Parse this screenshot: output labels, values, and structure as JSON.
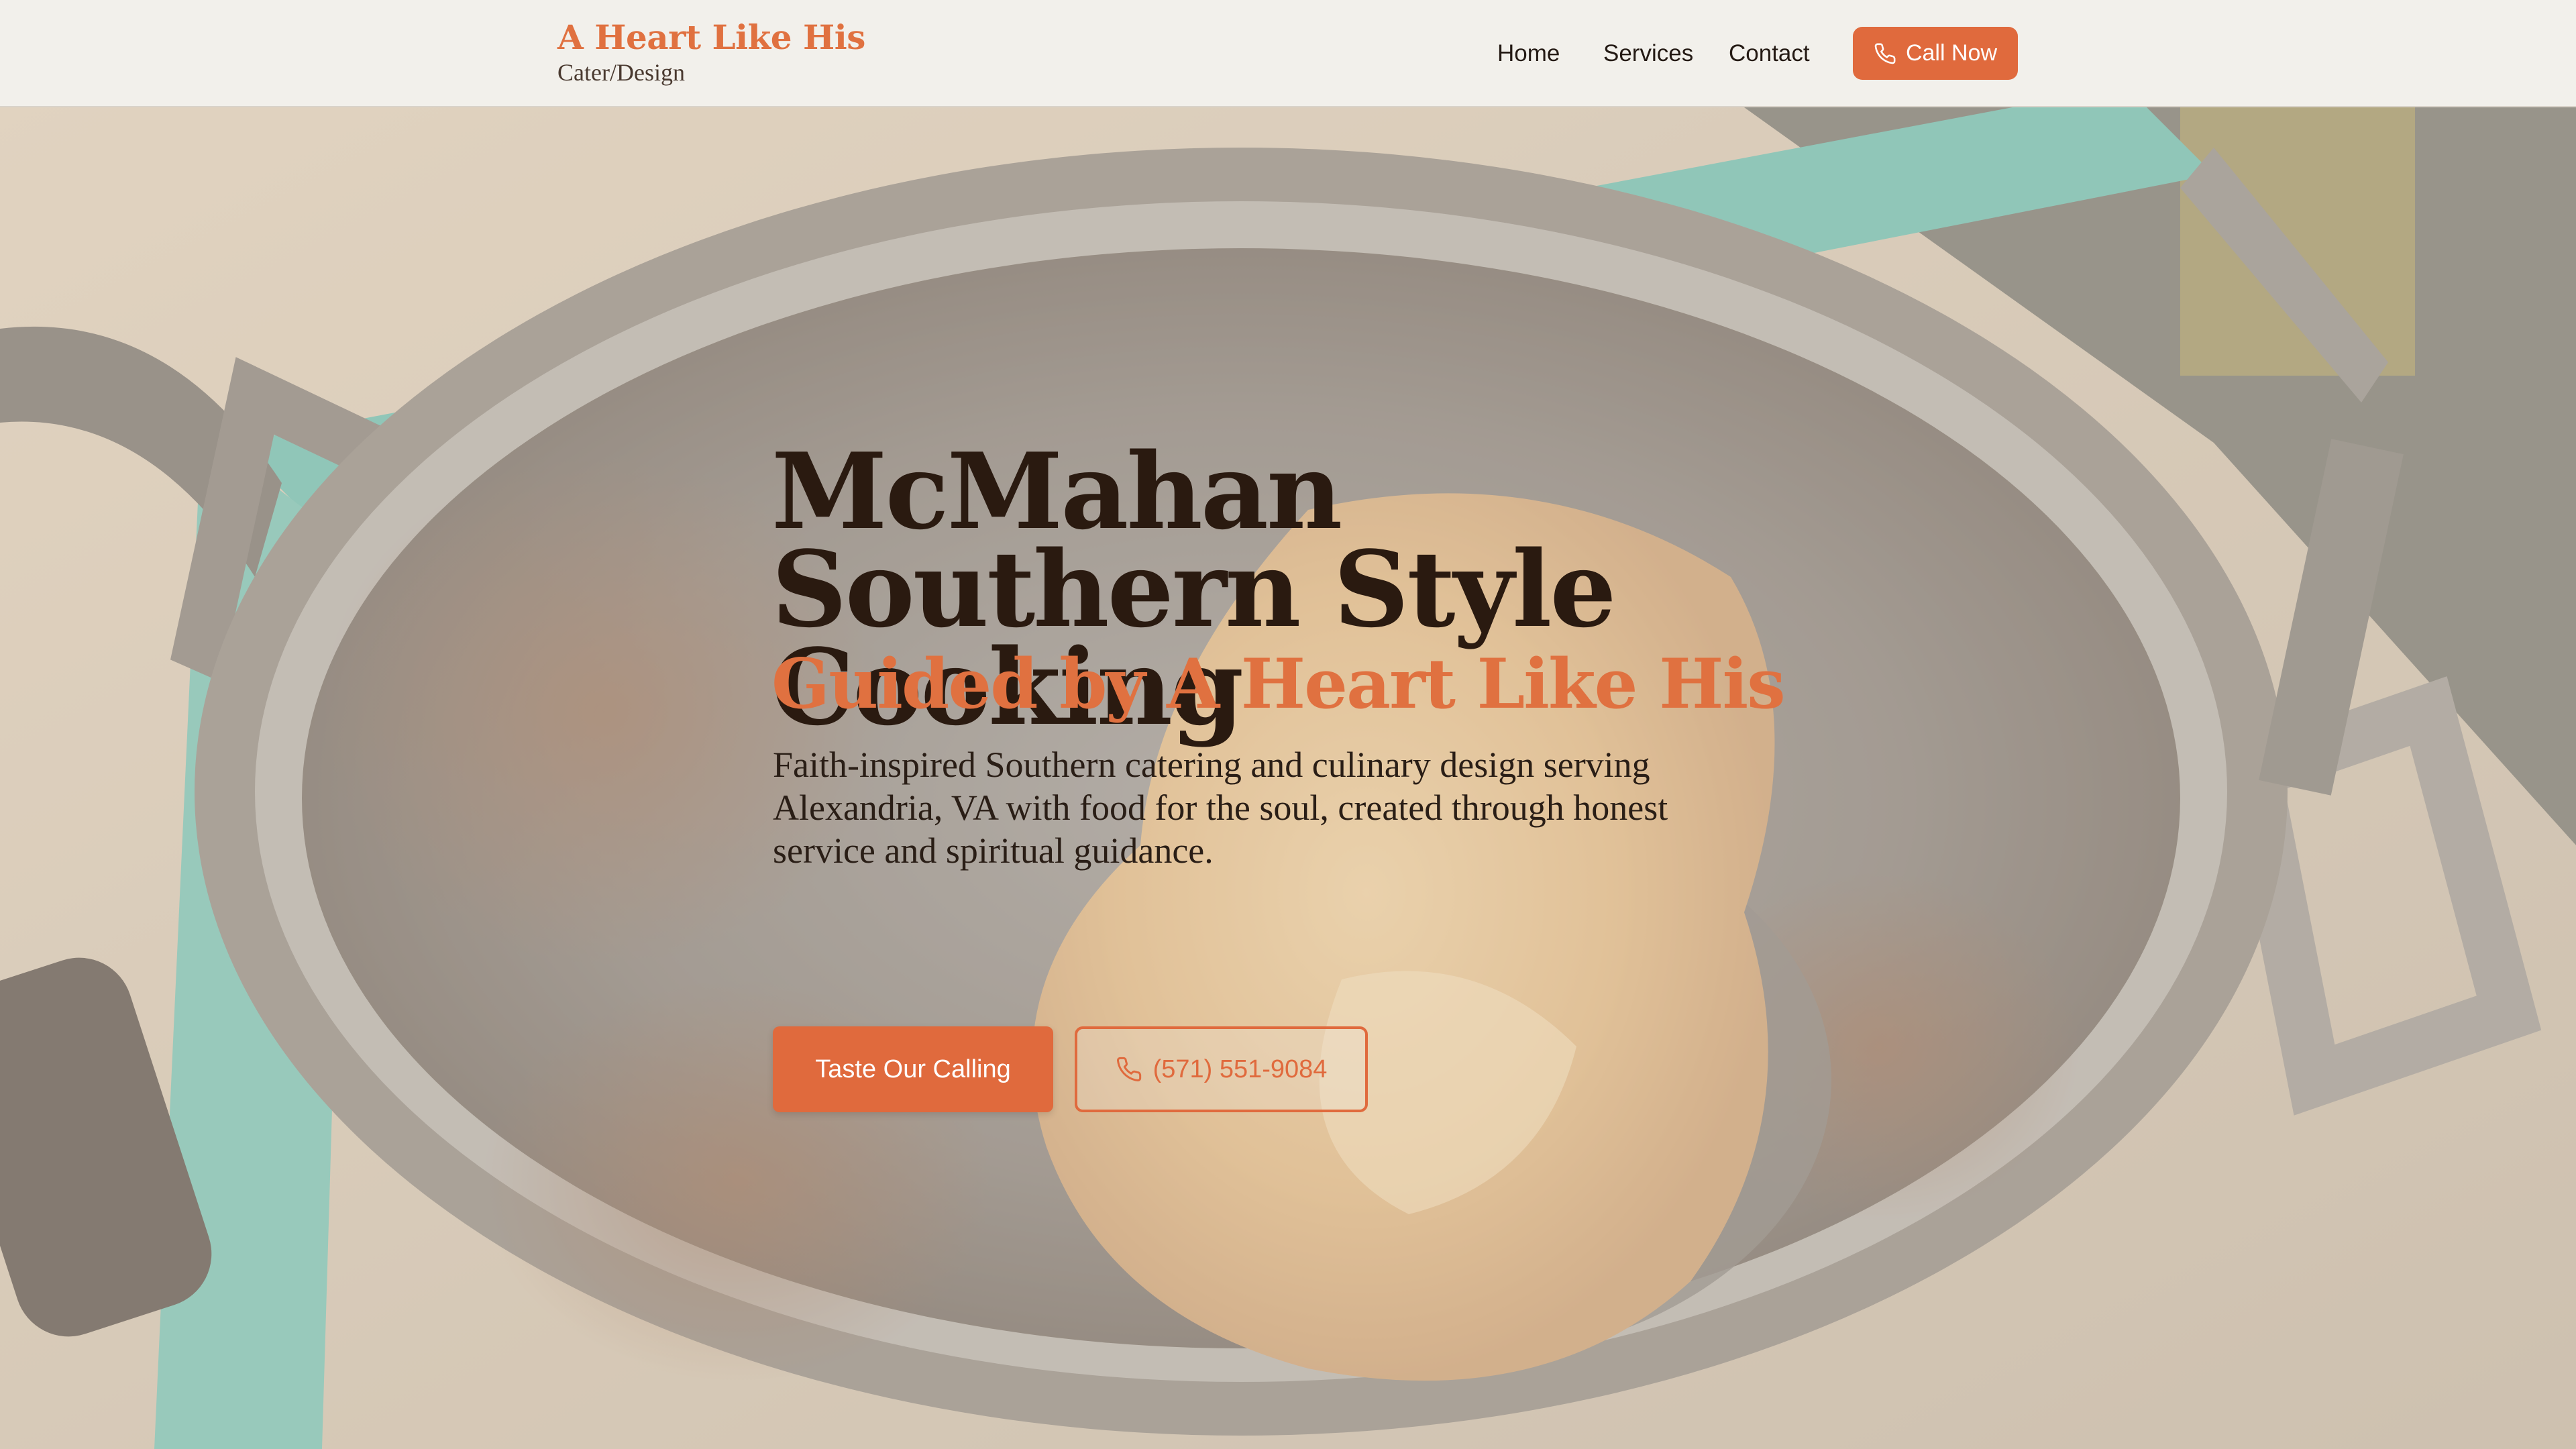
{
  "brand": {
    "title": "A Heart Like His",
    "subtitle": "Cater/Design"
  },
  "nav": {
    "items": [
      {
        "label": "Home"
      },
      {
        "label": "Services"
      },
      {
        "label": "Contact"
      }
    ],
    "call_now_label": "Call Now",
    "call_icon": "phone-icon"
  },
  "hero": {
    "title": "McMahan Southern Style Cooking",
    "subtitle": "Guided by A Heart Like His",
    "description": "Faith-inspired Southern catering and culinary design serving Alexandria, VA with food for the soul, created through honest service and spiritual guidance.",
    "primary_button_label": "Taste Our Calling",
    "phone_button_label": "(571) 551-9084",
    "background_image": "cast-iron-pan-photo"
  },
  "colors": {
    "accent": "#e06a3d",
    "header_bg": "#f2f0eb",
    "heading": "#2a1a10",
    "brand": "#e07140"
  }
}
